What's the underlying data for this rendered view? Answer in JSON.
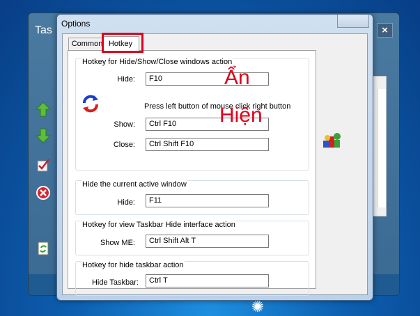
{
  "background_app": {
    "title": "Tas",
    "close_glyph": "×",
    "toolbar_icons": [
      "arrow-up-icon",
      "arrow-down-icon",
      "check-edit-icon",
      "delete-icon",
      "refresh-icon"
    ]
  },
  "dialog": {
    "title": "Options",
    "tabs": [
      {
        "label": "Common",
        "active": false
      },
      {
        "label": "Hotkey",
        "active": true
      }
    ]
  },
  "groups": {
    "hide_show_close": {
      "title": "Hotkey for Hide/Show/Close windows action",
      "hide_label": "Hide:",
      "hide_value": "F10",
      "note": "Press left button of mouse click right button",
      "show_label": "Show:",
      "show_value": "Ctrl  F10",
      "close_label": "Close:",
      "close_value": "Ctrl  Shift  F10"
    },
    "hide_active": {
      "title": "Hide the current active window",
      "hide_label": "Hide:",
      "hide_value": "F11"
    },
    "view_taskbar": {
      "title": "Hotkey for view Taskbar Hide interface action",
      "show_me_label": "Show ME:",
      "show_me_value": "Ctrl  Shift  Alt  T"
    },
    "hide_taskbar": {
      "title": "Hotkey for hide taskbar action",
      "hide_taskbar_label": "Hide Taskbar:",
      "hide_taskbar_value": "Ctrl  T"
    }
  },
  "annotations": {
    "an": "Ẩn",
    "hien": "Hiện",
    "color": "#e0001a"
  }
}
